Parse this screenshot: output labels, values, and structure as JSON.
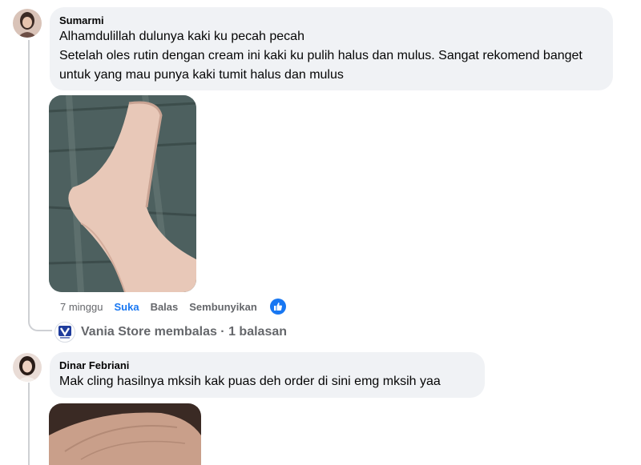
{
  "comments": [
    {
      "author": "Sumarmi",
      "text": "Alhamdulillah dulunya kaki ku pecah pecah\nSetelah oles rutin dengan cream ini kaki ku pulih halus dan mulus. Sangat rekomend banget untuk yang mau punya kaki tumit halus dan mulus",
      "actions": {
        "time": "7 minggu",
        "like": "Suka",
        "reply": "Balas",
        "hide": "Sembunyikan"
      },
      "reaction_icon": "thumbs-up-icon",
      "reply_summary": {
        "avatar_label": "Vania Store",
        "text": "Vania Store membalas · 1 balasan"
      }
    },
    {
      "author": "Dinar Febriani",
      "text": "Mak cling hasilnya mksih kak puas deh order di sini emg mksih yaa"
    }
  ],
  "colors": {
    "bubble_bg": "#f0f2f5",
    "secondary_text": "#65676b",
    "accent": "#1877f2",
    "thread_line": "#ced0d4"
  }
}
